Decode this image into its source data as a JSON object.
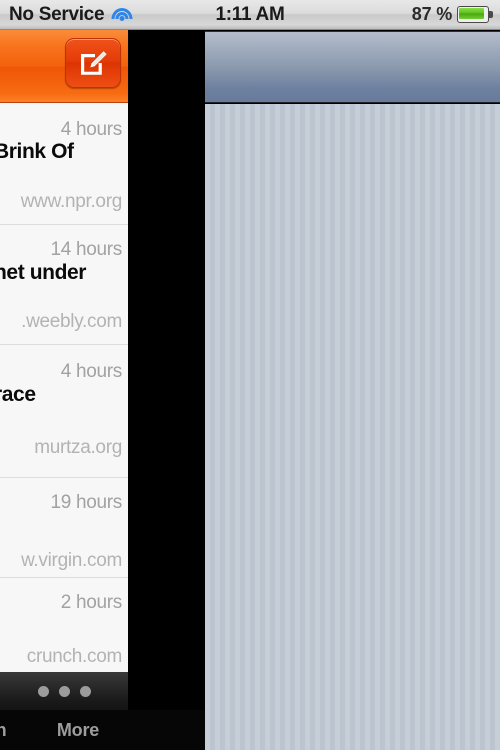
{
  "status_bar": {
    "carrier": "No Service",
    "wifi_icon": "wifi-icon",
    "time": "1:11 AM",
    "battery_percent": "87 %",
    "battery_icon": "battery-icon",
    "battery_level": 87,
    "battery_color": "#5cbf1a"
  },
  "left_panel": {
    "toolbar": {
      "accent_color": "#f4620d",
      "compose_button_label": "compose-icon"
    },
    "list": [
      {
        "time": "4 hours",
        "title": "Brink Of",
        "domain": "www.npr.org"
      },
      {
        "time": "14 hours",
        "title": "net under",
        "domain": ".weebly.com"
      },
      {
        "time": "4 hours",
        "title": "race",
        "domain": "murtza.org"
      },
      {
        "time": "19 hours",
        "title": "",
        "domain": "w.virgin.com"
      },
      {
        "time": "2 hours",
        "title": "",
        "domain": "crunch.com"
      }
    ],
    "page_dots": {
      "count": 3,
      "active_index": 0
    }
  },
  "tab_bar": {
    "items": [
      {
        "label": "h"
      },
      {
        "label": "More"
      }
    ]
  },
  "right_panel": {
    "navbar_color": "#8695ab",
    "body_color": "#c3cbd6"
  }
}
